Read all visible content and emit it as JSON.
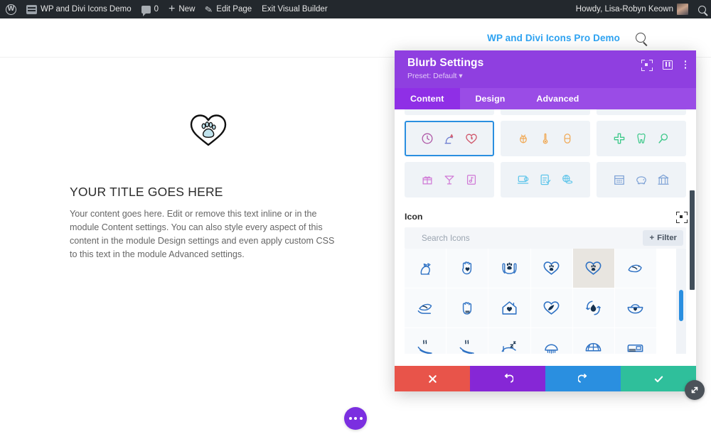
{
  "admin_bar": {
    "wp_logo_icon": "wordpress-logo-icon",
    "site_name": "WP and Divi Icons Demo",
    "site_icon": "site-dashboard-icon",
    "comments_icon": "comment-bubble-icon",
    "comments_count": "0",
    "new_icon": "plus-icon",
    "new_label": "New",
    "edit_icon": "pencil-icon",
    "edit_label": "Edit Page",
    "exit_label": "Exit Visual Builder",
    "howdy": "Howdy, Lisa-Robyn Keown",
    "avatar_icon": "user-avatar",
    "search_icon": "search-icon"
  },
  "site_header": {
    "nav_link": "WP and Divi Icons Pro Demo",
    "search_icon": "search-icon"
  },
  "blurb": {
    "icon_name": "heart-with-paw-print-icon",
    "title": "YOUR TITLE GOES HERE",
    "body": "Your content goes here. Edit or remove this text inline or in the module Content settings. You can also style every aspect of this content in the module Design settings and even apply custom CSS to this text in the module Advanced settings.",
    "fab_icon": "ellipsis-icon"
  },
  "modal": {
    "title": "Blurb Settings",
    "preset": "Preset: Default",
    "preset_caret": "▾",
    "header_actions": [
      {
        "name": "focus-target-icon"
      },
      {
        "name": "layout-columns-icon"
      },
      {
        "name": "kebab-menu-icon"
      }
    ],
    "tabs": [
      {
        "label": "Content",
        "active": true
      },
      {
        "label": "Design",
        "active": false
      },
      {
        "label": "Advanced",
        "active": false
      }
    ],
    "icon_groups": [
      {
        "id": "g-clip-1",
        "clipped": true,
        "selected": false,
        "icons": []
      },
      {
        "id": "g-clip-2",
        "clipped": true,
        "selected": false,
        "icons": []
      },
      {
        "id": "g-clip-3",
        "clipped": true,
        "selected": false,
        "icons": []
      },
      {
        "id": "g-pets",
        "clipped": false,
        "selected": true,
        "icons": [
          {
            "name": "clock-icon",
            "color": "#b05aa8"
          },
          {
            "name": "cat-icon",
            "color": "#6f7fd1"
          },
          {
            "name": "heart-leaf-icon",
            "color": "#d0566a"
          }
        ]
      },
      {
        "id": "g-insects",
        "clipped": false,
        "selected": false,
        "icons": [
          {
            "name": "bug-icon",
            "color": "#f0a955"
          },
          {
            "name": "thermometer-icon",
            "color": "#f0a955"
          },
          {
            "name": "pill-icon",
            "color": "#f0a955"
          }
        ]
      },
      {
        "id": "g-medical",
        "clipped": false,
        "selected": false,
        "icons": [
          {
            "name": "medical-cross-icon",
            "color": "#3fc98b"
          },
          {
            "name": "tooth-icon",
            "color": "#3fc98b"
          },
          {
            "name": "magnifier-icon",
            "color": "#3fc98b"
          }
        ]
      },
      {
        "id": "g-gifts",
        "clipped": false,
        "selected": false,
        "icons": [
          {
            "name": "gift-box-icon",
            "color": "#d07ad6"
          },
          {
            "name": "cocktail-icon",
            "color": "#d07ad6"
          },
          {
            "name": "music-book-icon",
            "color": "#d07ad6"
          }
        ]
      },
      {
        "id": "g-business",
        "clipped": false,
        "selected": false,
        "icons": [
          {
            "name": "laptop-settings-icon",
            "color": "#5fc5ea"
          },
          {
            "name": "checklist-icon",
            "color": "#5fc5ea"
          },
          {
            "name": "globe-coins-icon",
            "color": "#5fc5ea"
          }
        ]
      },
      {
        "id": "g-finance",
        "clipped": false,
        "selected": false,
        "icons": [
          {
            "name": "calendar-icon",
            "color": "#7fa3d6"
          },
          {
            "name": "piggy-bank-icon",
            "color": "#7fa3d6"
          },
          {
            "name": "bank-icon",
            "color": "#7fa3d6"
          }
        ]
      }
    ],
    "icon_field": {
      "label": "Icon",
      "reset_icon": "focus-target-icon"
    },
    "search": {
      "placeholder": "Search Icons",
      "value": "",
      "filter_label": "Filter",
      "filter_plus_icon": "plus-icon"
    },
    "icon_results": [
      {
        "name": "cat-sitting-icon",
        "selected": false
      },
      {
        "name": "hand-with-heart-icon",
        "selected": false
      },
      {
        "name": "hands-holding-paw-icon",
        "selected": false
      },
      {
        "name": "heart-paw-outline-icon",
        "selected": false
      },
      {
        "name": "heart-paw-filled-icon",
        "selected": true
      },
      {
        "name": "bird-icon",
        "selected": false
      },
      {
        "name": "hand-holding-bird-icon",
        "selected": false
      },
      {
        "name": "hand-paw-print-icon",
        "selected": false
      },
      {
        "name": "house-heart-icon",
        "selected": false
      },
      {
        "name": "heart-feather-icon",
        "selected": false
      },
      {
        "name": "water-recycle-icon",
        "selected": false
      },
      {
        "name": "pet-food-bowl-icon",
        "selected": false
      },
      {
        "name": "paw-steam-icon",
        "selected": false
      },
      {
        "name": "paw-steam-alt-icon",
        "selected": false
      },
      {
        "name": "sleeping-pet-icon",
        "selected": false
      },
      {
        "name": "pet-brush-icon",
        "selected": false
      },
      {
        "name": "globe-net-icon",
        "selected": false
      },
      {
        "name": "pet-carrier-icon",
        "selected": false
      }
    ],
    "actions": [
      {
        "name": "cancel-button",
        "icon": "close-x-icon",
        "color": "#e8544a"
      },
      {
        "name": "undo-button",
        "icon": "undo-arrow-icon",
        "color": "#8627d6"
      },
      {
        "name": "redo-button",
        "icon": "redo-arrow-icon",
        "color": "#2a8fe0"
      },
      {
        "name": "save-button",
        "icon": "checkmark-icon",
        "color": "#2fbf9b"
      }
    ],
    "resize_handle_icon": "resize-diagonal-icon"
  }
}
